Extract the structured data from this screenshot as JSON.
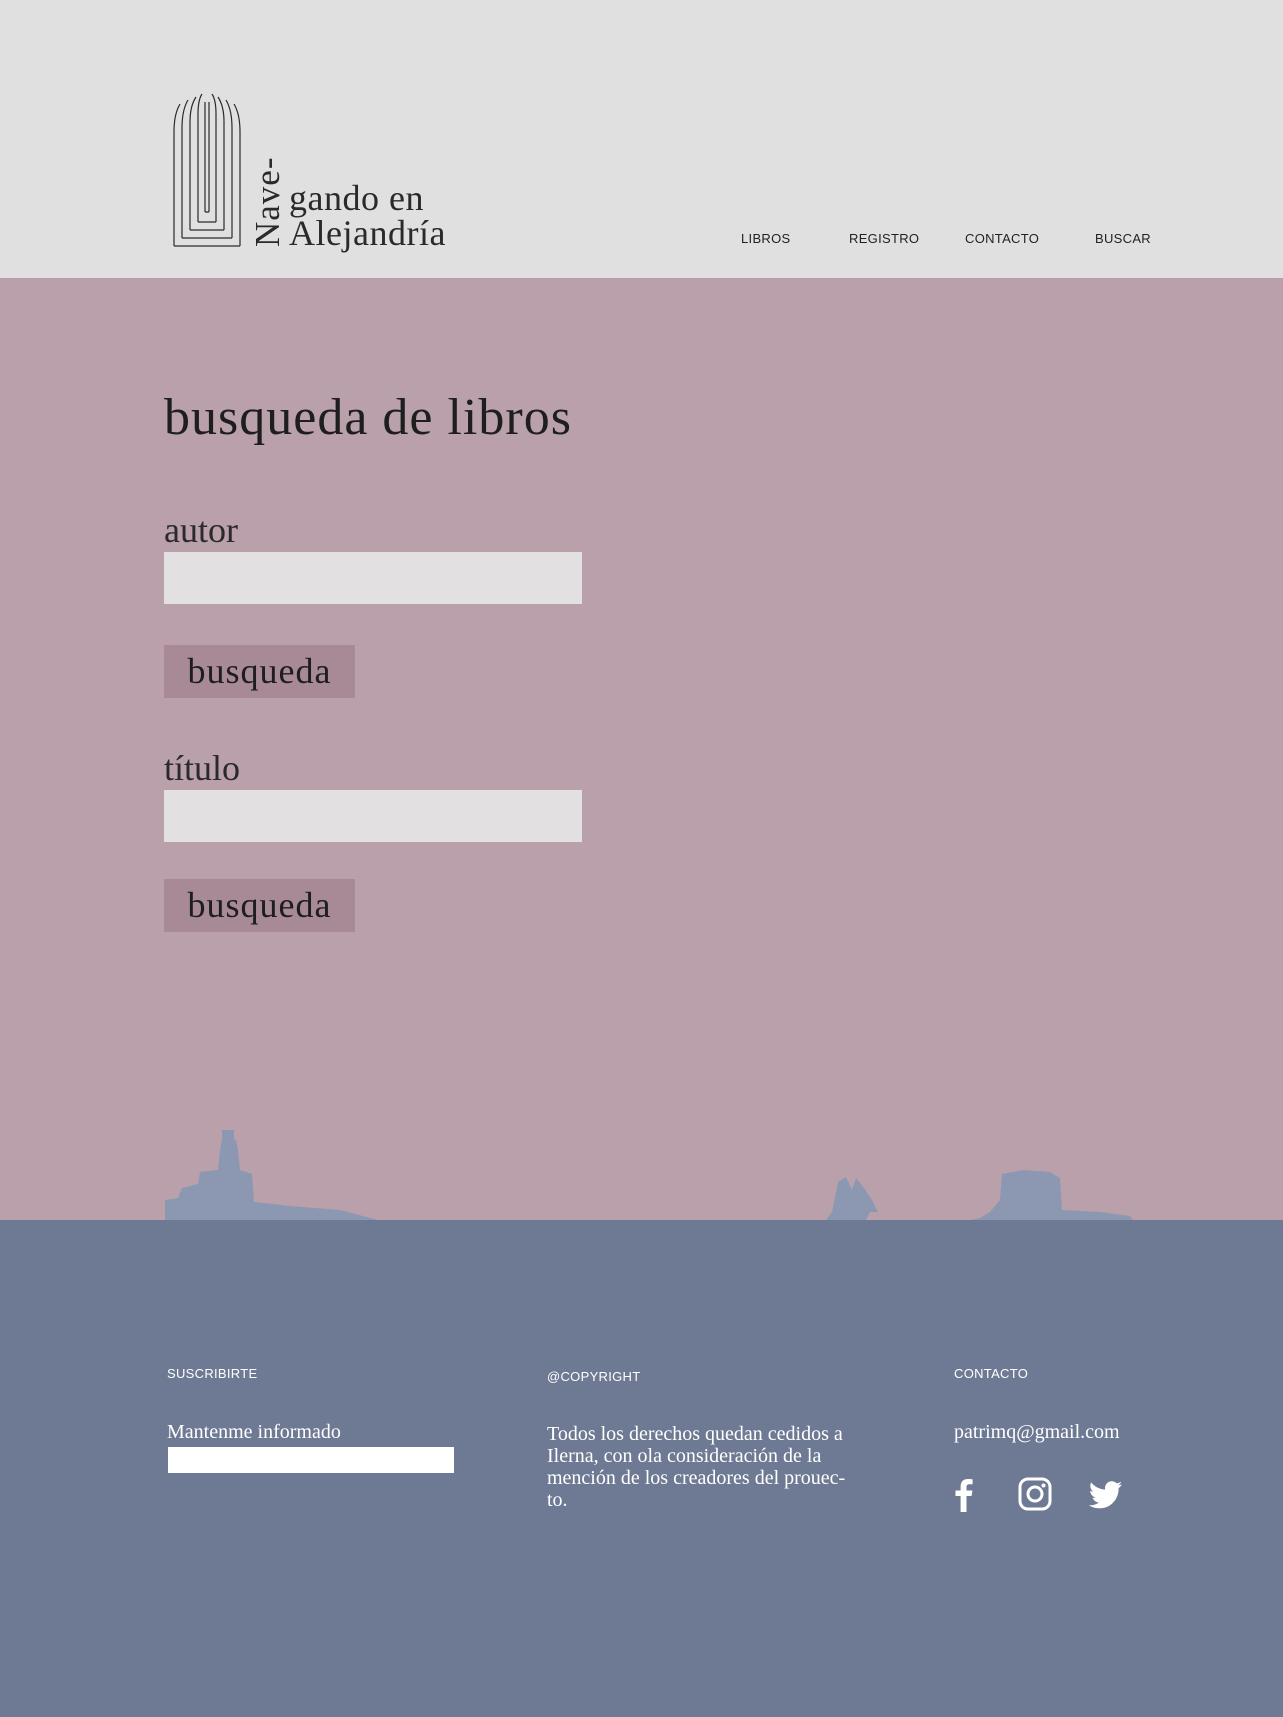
{
  "brand": {
    "vertical_text": "Nave-",
    "line1": "gando en",
    "line2": "Alejandría"
  },
  "nav": {
    "items": [
      {
        "label": "LIBROS"
      },
      {
        "label": "REGISTRO"
      },
      {
        "label": "CONTACTO"
      },
      {
        "label": "BUSCAR"
      }
    ]
  },
  "main": {
    "title": "busqueda de libros",
    "author_label": "autor",
    "author_value": "",
    "author_button": "busqueda",
    "title_label": "título",
    "title_value": "",
    "title_button": "busqueda"
  },
  "footer": {
    "subscribe": {
      "heading": "SUSCRIBIRTE",
      "label": "Mantenme informado",
      "value": ""
    },
    "copyright": {
      "heading": "@COPYRIGHT",
      "text": "Todos los derechos quedan cedidos a Ilerna, con ola consideración de la mención de los creadores del prouec-to."
    },
    "contact": {
      "heading": "CONTACTO",
      "email": "patrimq@gmail.com"
    },
    "social_icons": [
      "facebook-icon",
      "instagram-icon",
      "twitter-icon"
    ]
  },
  "colors": {
    "header_bg": "#e0e0e0",
    "main_bg": "#b9a0aa",
    "footer_bg": "#6e7a94",
    "button_bg": "#a78a96",
    "input_bg": "#e2e0e1",
    "scenery": "#8c98b2"
  }
}
